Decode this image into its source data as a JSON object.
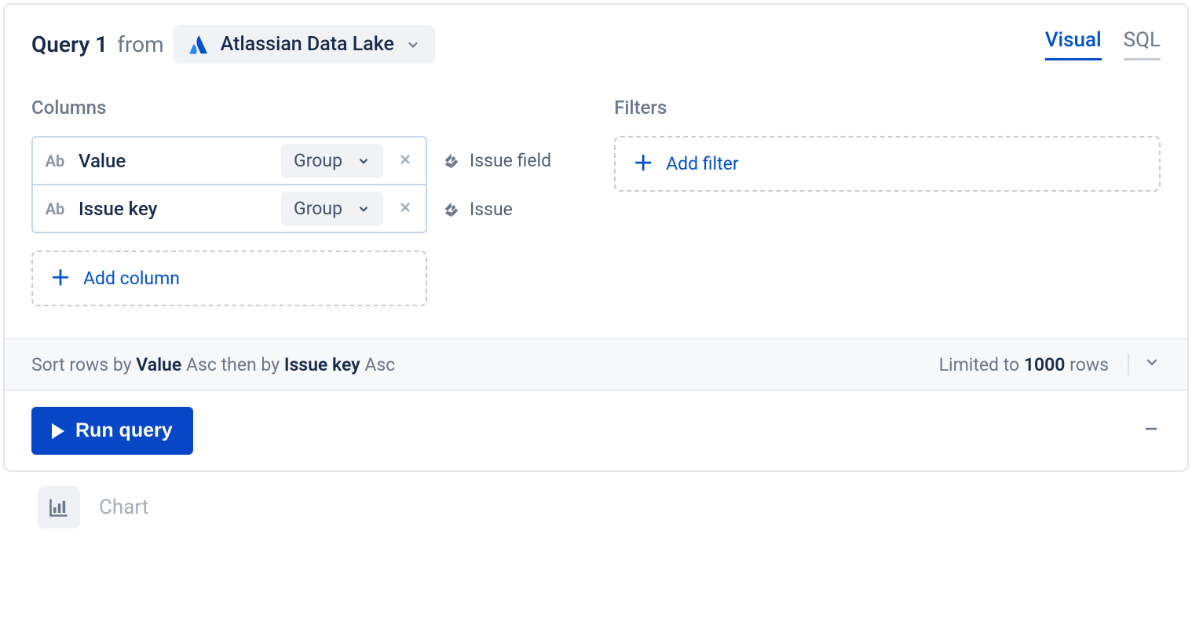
{
  "header": {
    "query_title": "Query 1",
    "from_label": "from",
    "source_name": "Atlassian Data Lake"
  },
  "tabs": {
    "visual": "Visual",
    "sql": "SQL"
  },
  "sections": {
    "columns_label": "Columns",
    "filters_label": "Filters"
  },
  "columns": [
    {
      "type_badge": "Ab",
      "name": "Value",
      "agg": "Group",
      "source": "Issue field"
    },
    {
      "type_badge": "Ab",
      "name": "Issue key",
      "agg": "Group",
      "source": "Issue"
    }
  ],
  "actions": {
    "add_column": "Add column",
    "add_filter": "Add filter",
    "run_query": "Run query"
  },
  "sort": {
    "prefix": "Sort rows by",
    "col1": "Value",
    "dir1": "Asc",
    "then": "then by",
    "col2": "Issue key",
    "dir2": "Asc"
  },
  "limit": {
    "prefix": "Limited to",
    "value": "1000",
    "suffix": "rows"
  },
  "chart": {
    "label": "Chart"
  }
}
